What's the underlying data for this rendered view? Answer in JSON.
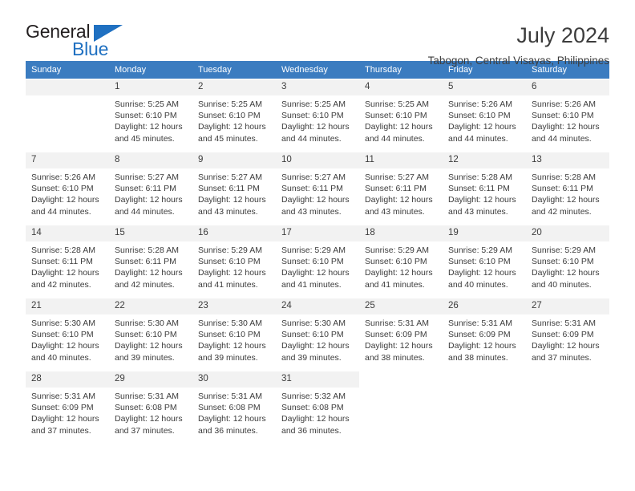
{
  "logo": {
    "word_one": "General",
    "word_two": "Blue",
    "triangle_icon": "triangle-icon",
    "brand_blue": "#1f70c1",
    "brand_dark": "#231f20"
  },
  "header": {
    "title": "July 2024",
    "subtitle": "Tabogon, Central Visayas, Philippines"
  },
  "calendar": {
    "header_bg": "#3b7cc0",
    "header_text_color": "#ffffff",
    "daynum_bg": "#f2f2f2",
    "weekday_headers": [
      "Sunday",
      "Monday",
      "Tuesday",
      "Wednesday",
      "Thursday",
      "Friday",
      "Saturday"
    ],
    "labels": {
      "sunrise": "Sunrise:",
      "sunset": "Sunset:",
      "daylight": "Daylight:"
    },
    "weeks": [
      [
        {
          "day": "",
          "sunrise": "",
          "sunset": "",
          "daylight": "",
          "empty": true
        },
        {
          "day": "1",
          "sunrise": "Sunrise: 5:25 AM",
          "sunset": "Sunset: 6:10 PM",
          "daylight": "Daylight: 12 hours and 45 minutes."
        },
        {
          "day": "2",
          "sunrise": "Sunrise: 5:25 AM",
          "sunset": "Sunset: 6:10 PM",
          "daylight": "Daylight: 12 hours and 45 minutes."
        },
        {
          "day": "3",
          "sunrise": "Sunrise: 5:25 AM",
          "sunset": "Sunset: 6:10 PM",
          "daylight": "Daylight: 12 hours and 44 minutes."
        },
        {
          "day": "4",
          "sunrise": "Sunrise: 5:25 AM",
          "sunset": "Sunset: 6:10 PM",
          "daylight": "Daylight: 12 hours and 44 minutes."
        },
        {
          "day": "5",
          "sunrise": "Sunrise: 5:26 AM",
          "sunset": "Sunset: 6:10 PM",
          "daylight": "Daylight: 12 hours and 44 minutes."
        },
        {
          "day": "6",
          "sunrise": "Sunrise: 5:26 AM",
          "sunset": "Sunset: 6:10 PM",
          "daylight": "Daylight: 12 hours and 44 minutes."
        }
      ],
      [
        {
          "day": "7",
          "sunrise": "Sunrise: 5:26 AM",
          "sunset": "Sunset: 6:10 PM",
          "daylight": "Daylight: 12 hours and 44 minutes."
        },
        {
          "day": "8",
          "sunrise": "Sunrise: 5:27 AM",
          "sunset": "Sunset: 6:11 PM",
          "daylight": "Daylight: 12 hours and 44 minutes."
        },
        {
          "day": "9",
          "sunrise": "Sunrise: 5:27 AM",
          "sunset": "Sunset: 6:11 PM",
          "daylight": "Daylight: 12 hours and 43 minutes."
        },
        {
          "day": "10",
          "sunrise": "Sunrise: 5:27 AM",
          "sunset": "Sunset: 6:11 PM",
          "daylight": "Daylight: 12 hours and 43 minutes."
        },
        {
          "day": "11",
          "sunrise": "Sunrise: 5:27 AM",
          "sunset": "Sunset: 6:11 PM",
          "daylight": "Daylight: 12 hours and 43 minutes."
        },
        {
          "day": "12",
          "sunrise": "Sunrise: 5:28 AM",
          "sunset": "Sunset: 6:11 PM",
          "daylight": "Daylight: 12 hours and 43 minutes."
        },
        {
          "day": "13",
          "sunrise": "Sunrise: 5:28 AM",
          "sunset": "Sunset: 6:11 PM",
          "daylight": "Daylight: 12 hours and 42 minutes."
        }
      ],
      [
        {
          "day": "14",
          "sunrise": "Sunrise: 5:28 AM",
          "sunset": "Sunset: 6:11 PM",
          "daylight": "Daylight: 12 hours and 42 minutes."
        },
        {
          "day": "15",
          "sunrise": "Sunrise: 5:28 AM",
          "sunset": "Sunset: 6:11 PM",
          "daylight": "Daylight: 12 hours and 42 minutes."
        },
        {
          "day": "16",
          "sunrise": "Sunrise: 5:29 AM",
          "sunset": "Sunset: 6:10 PM",
          "daylight": "Daylight: 12 hours and 41 minutes."
        },
        {
          "day": "17",
          "sunrise": "Sunrise: 5:29 AM",
          "sunset": "Sunset: 6:10 PM",
          "daylight": "Daylight: 12 hours and 41 minutes."
        },
        {
          "day": "18",
          "sunrise": "Sunrise: 5:29 AM",
          "sunset": "Sunset: 6:10 PM",
          "daylight": "Daylight: 12 hours and 41 minutes."
        },
        {
          "day": "19",
          "sunrise": "Sunrise: 5:29 AM",
          "sunset": "Sunset: 6:10 PM",
          "daylight": "Daylight: 12 hours and 40 minutes."
        },
        {
          "day": "20",
          "sunrise": "Sunrise: 5:29 AM",
          "sunset": "Sunset: 6:10 PM",
          "daylight": "Daylight: 12 hours and 40 minutes."
        }
      ],
      [
        {
          "day": "21",
          "sunrise": "Sunrise: 5:30 AM",
          "sunset": "Sunset: 6:10 PM",
          "daylight": "Daylight: 12 hours and 40 minutes."
        },
        {
          "day": "22",
          "sunrise": "Sunrise: 5:30 AM",
          "sunset": "Sunset: 6:10 PM",
          "daylight": "Daylight: 12 hours and 39 minutes."
        },
        {
          "day": "23",
          "sunrise": "Sunrise: 5:30 AM",
          "sunset": "Sunset: 6:10 PM",
          "daylight": "Daylight: 12 hours and 39 minutes."
        },
        {
          "day": "24",
          "sunrise": "Sunrise: 5:30 AM",
          "sunset": "Sunset: 6:10 PM",
          "daylight": "Daylight: 12 hours and 39 minutes."
        },
        {
          "day": "25",
          "sunrise": "Sunrise: 5:31 AM",
          "sunset": "Sunset: 6:09 PM",
          "daylight": "Daylight: 12 hours and 38 minutes."
        },
        {
          "day": "26",
          "sunrise": "Sunrise: 5:31 AM",
          "sunset": "Sunset: 6:09 PM",
          "daylight": "Daylight: 12 hours and 38 minutes."
        },
        {
          "day": "27",
          "sunrise": "Sunrise: 5:31 AM",
          "sunset": "Sunset: 6:09 PM",
          "daylight": "Daylight: 12 hours and 37 minutes."
        }
      ],
      [
        {
          "day": "28",
          "sunrise": "Sunrise: 5:31 AM",
          "sunset": "Sunset: 6:09 PM",
          "daylight": "Daylight: 12 hours and 37 minutes."
        },
        {
          "day": "29",
          "sunrise": "Sunrise: 5:31 AM",
          "sunset": "Sunset: 6:08 PM",
          "daylight": "Daylight: 12 hours and 37 minutes."
        },
        {
          "day": "30",
          "sunrise": "Sunrise: 5:31 AM",
          "sunset": "Sunset: 6:08 PM",
          "daylight": "Daylight: 12 hours and 36 minutes."
        },
        {
          "day": "31",
          "sunrise": "Sunrise: 5:32 AM",
          "sunset": "Sunset: 6:08 PM",
          "daylight": "Daylight: 12 hours and 36 minutes."
        },
        {
          "day": "",
          "sunrise": "",
          "sunset": "",
          "daylight": "",
          "blank": true
        },
        {
          "day": "",
          "sunrise": "",
          "sunset": "",
          "daylight": "",
          "blank": true
        },
        {
          "day": "",
          "sunrise": "",
          "sunset": "",
          "daylight": "",
          "blank": true
        }
      ]
    ]
  }
}
